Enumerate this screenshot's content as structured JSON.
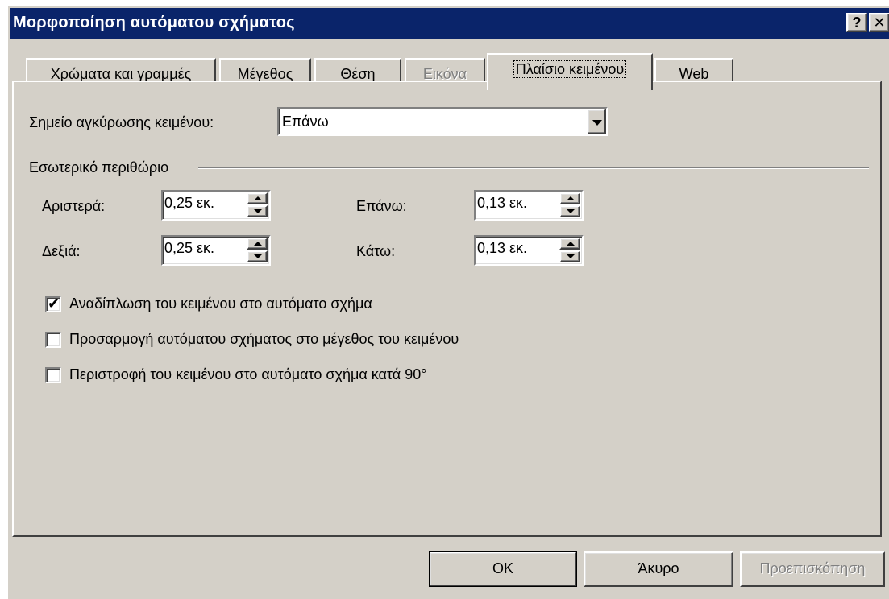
{
  "window": {
    "title": "Μορφοποίηση αυτόματου σχήματος",
    "help_label": "?",
    "close_label": "✕"
  },
  "tabs": [
    {
      "label": "Χρώματα και γραμμές",
      "state": "normal"
    },
    {
      "label": "Μέγεθος",
      "state": "normal"
    },
    {
      "label": "Θέση",
      "state": "normal"
    },
    {
      "label": "Εικόνα",
      "state": "disabled"
    },
    {
      "label": "Πλαίσιο κειμένου",
      "state": "active"
    },
    {
      "label": "Web",
      "state": "normal"
    }
  ],
  "anchor": {
    "label": "Σημείο αγκύρωσης κειμένου:",
    "value": "Επάνω"
  },
  "margins": {
    "group_label": "Εσωτερικό περιθώριο",
    "left": {
      "label": "Αριστερά:",
      "value": "0,25 εκ."
    },
    "right": {
      "label": "Δεξιά:",
      "value": "0,25 εκ."
    },
    "top": {
      "label": "Επάνω:",
      "value": "0,13 εκ."
    },
    "bottom": {
      "label": "Κάτω:",
      "value": "0,13 εκ."
    }
  },
  "options": [
    {
      "label": "Αναδίπλωση του κειμένου στο αυτόματο σχήμα",
      "checked": true
    },
    {
      "label": "Προσαρμογή αυτόματου σχήματος στο μέγεθος του κειμένου",
      "checked": false
    },
    {
      "label": "Περιστροφή του κειμένου στο αυτόματο σχήμα κατά 90°",
      "checked": false
    }
  ],
  "check_mark": "✔",
  "buttons": {
    "ok": "OK",
    "cancel": "Άκυρο",
    "preview": "Προεπισκόπηση"
  },
  "colors": {
    "titlebar": "#0a246a",
    "dialog_face": "#d4d0c8"
  }
}
